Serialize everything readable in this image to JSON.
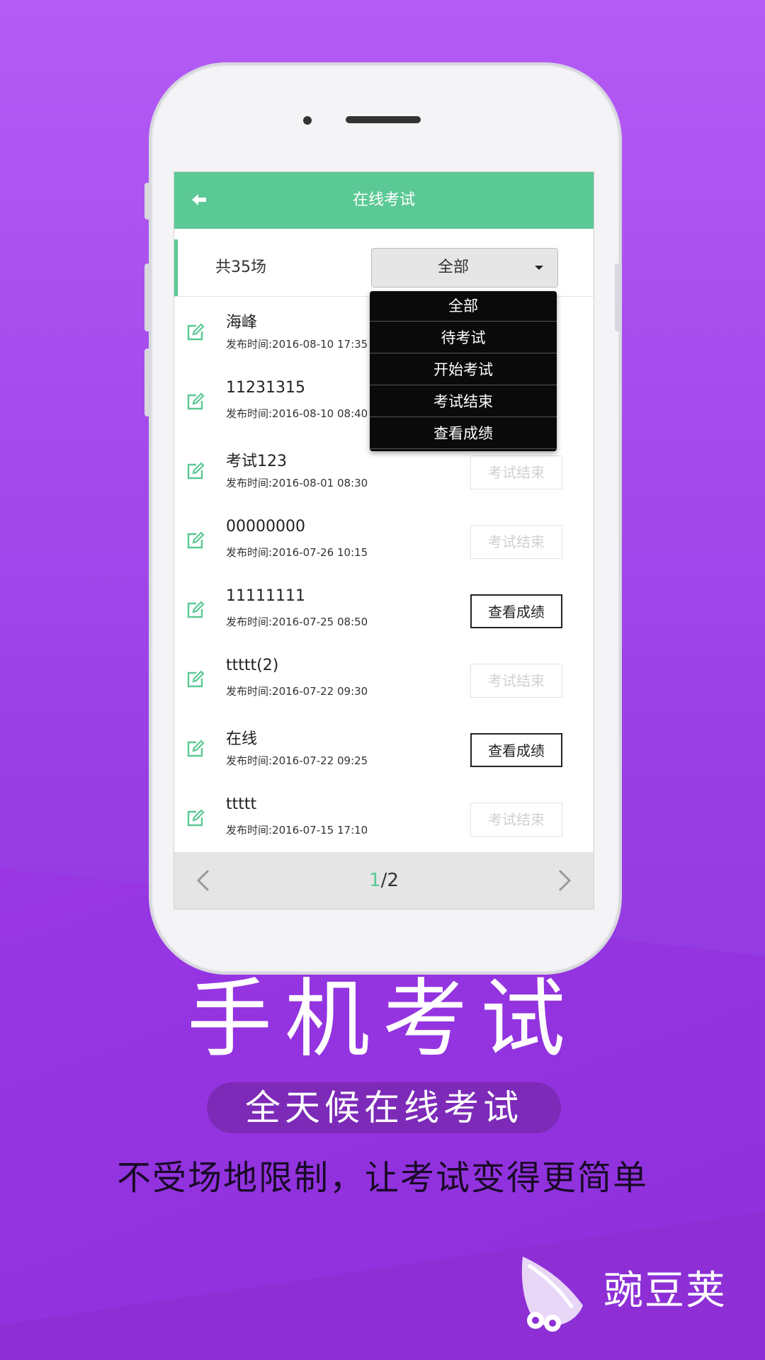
{
  "appbar": {
    "title": "在线考试"
  },
  "filter": {
    "count_label": "共35场",
    "selected": "全部"
  },
  "dropdown": {
    "options": [
      "全部",
      "待考试",
      "开始考试",
      "考试结束",
      "查看成绩"
    ]
  },
  "exams": [
    {
      "title": "海峰",
      "time": "发布时间:2016-08-10 17:35",
      "action": ""
    },
    {
      "title": "11231315",
      "time": "发布时间:2016-08-10 08:40",
      "action": ""
    },
    {
      "title": "考试123",
      "time": "发布时间:2016-08-01 08:30",
      "action": "考试结束"
    },
    {
      "title": "00000000",
      "time": "发布时间:2016-07-26 10:15",
      "action": "考试结束"
    },
    {
      "title": "11111111",
      "time": "发布时间:2016-07-25 08:50",
      "action": "查看成绩"
    },
    {
      "title": "ttttt(2)",
      "time": "发布时间:2016-07-22 09:30",
      "action": "考试结束"
    },
    {
      "title": "在线",
      "time": "发布时间:2016-07-22 09:25",
      "action": "查看成绩"
    },
    {
      "title": "ttttt",
      "time": "发布时间:2016-07-15 17:10",
      "action": "考试结束"
    }
  ],
  "pager": {
    "current": "1",
    "total": "/2"
  },
  "promo": {
    "headline": "手机考试",
    "pill": "全天候在线考试",
    "tagline": "不受场地限制，让考试变得更简单"
  },
  "brand": {
    "name": "豌豆荚"
  },
  "colors": {
    "accent": "#5bc995",
    "background": "#a94ef0"
  }
}
